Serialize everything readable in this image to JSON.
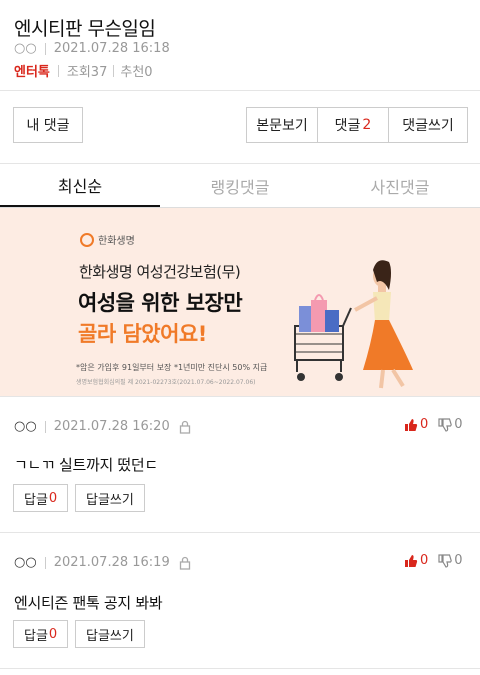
{
  "post": {
    "title": "엔시티판 무슨일임",
    "author": "○○",
    "datetime": "2021.07.28 16:18",
    "category": "엔터톡",
    "views": "조회37",
    "likes": "추천0"
  },
  "actions": {
    "my_comments": "내 댓글",
    "view_body": "본문보기",
    "comments_label": "댓글",
    "comments_count": "2",
    "write_comment": "댓글쓰기"
  },
  "tabs": [
    "최신순",
    "랭킹댓글",
    "사진댓글"
  ],
  "ad": {
    "brand": "한화생명",
    "line1": "한화생명 여성건강보험(무)",
    "line2": "여성을 위한 보장만",
    "line3": "골라 담았어요!",
    "line4": "*암은 가입후 91일부터 보장 *1년미만 진단시 50% 지급",
    "line5": "생명보험협회심의필 제 2021-02273호(2021.07.06~2022.07.06)"
  },
  "comments": [
    {
      "author": "○○",
      "datetime": "2021.07.28 16:20",
      "up": "0",
      "down": "0",
      "text": "ㄱㄴㄲ 실트까지 떴던ㄷ",
      "reply_label": "답글",
      "reply_count": "0",
      "write_reply": "답글쓰기"
    },
    {
      "author": "○○",
      "datetime": "2021.07.28 16:19",
      "up": "0",
      "down": "0",
      "text": "엔시티즌 팬톡 공지 봐봐",
      "reply_label": "답글",
      "reply_count": "0",
      "write_reply": "답글쓰기"
    }
  ]
}
